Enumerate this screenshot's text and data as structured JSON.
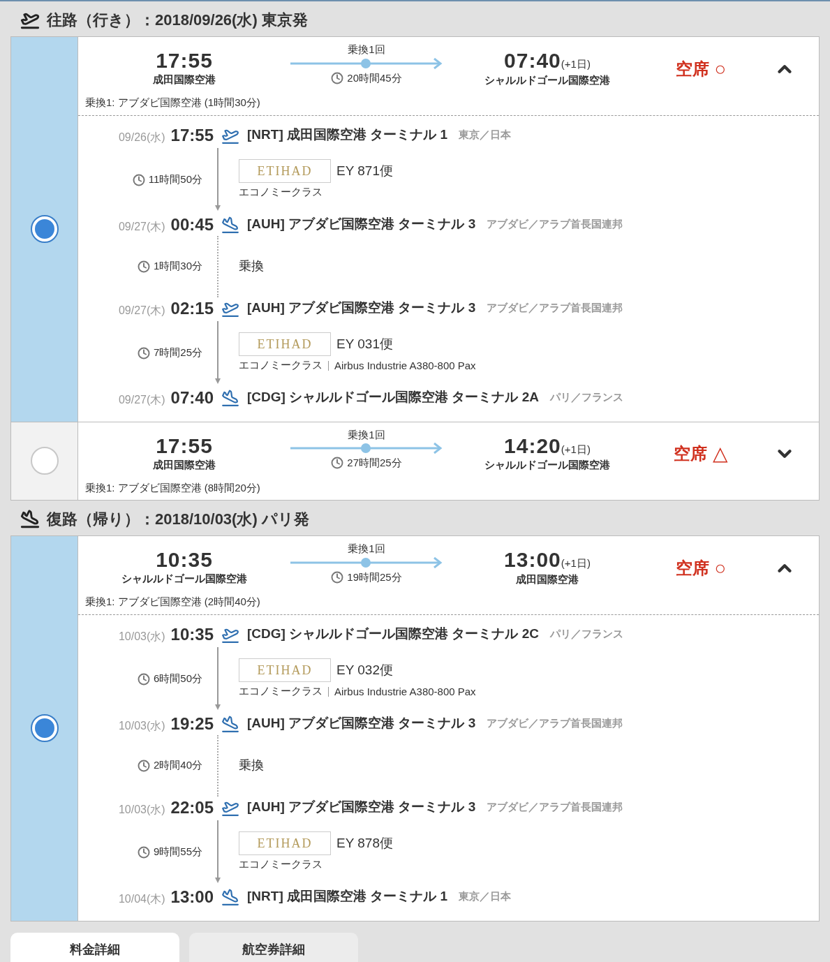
{
  "sections": [
    {
      "kind": "outbound",
      "title": "往路（行き）：2018/09/26(水) 東京発",
      "options": [
        {
          "selected": true,
          "expanded": true,
          "depart_time": "17:55",
          "depart_airport": "成田国際空港",
          "stops": "乗換1回",
          "duration": "20時間45分",
          "arrive_time": "07:40",
          "arrive_day": "(+1日)",
          "arrive_airport": "シャルルドゴール国際空港",
          "availability": "空席",
          "availability_mark": "○",
          "transfer_note": "乗換1: アブダビ国際空港 (1時間30分)",
          "timeline": [
            {
              "kind": "departure",
              "date": "09/26(水)",
              "time": "17:55",
              "airport": "[NRT] 成田国際空港 ターミナル 1",
              "region": "東京／日本"
            },
            {
              "kind": "flight",
              "duration": "11時間50分",
              "logo": "ETIHAD",
              "flight_no": "EY 871便",
              "cabin": "エコノミークラス"
            },
            {
              "kind": "arrival",
              "date": "09/27(木)",
              "time": "00:45",
              "airport": "[AUH] アブダビ国際空港 ターミナル 3",
              "region": "アブダビ／アラブ首長国連邦"
            },
            {
              "kind": "transfer",
              "duration": "1時間30分",
              "label": "乗換"
            },
            {
              "kind": "departure",
              "date": "09/27(木)",
              "time": "02:15",
              "airport": "[AUH] アブダビ国際空港 ターミナル 3",
              "region": "アブダビ／アラブ首長国連邦"
            },
            {
              "kind": "flight",
              "duration": "7時間25分",
              "logo": "ETIHAD",
              "flight_no": "EY 031便",
              "cabin": "エコノミークラス",
              "aircraft": "Airbus Industrie A380-800 Pax"
            },
            {
              "kind": "arrival",
              "date": "09/27(木)",
              "time": "07:40",
              "airport": "[CDG] シャルルドゴール国際空港 ターミナル 2A",
              "region": "パリ／フランス"
            }
          ]
        },
        {
          "selected": false,
          "expanded": false,
          "depart_time": "17:55",
          "depart_airport": "成田国際空港",
          "stops": "乗換1回",
          "duration": "27時間25分",
          "arrive_time": "14:20",
          "arrive_day": "(+1日)",
          "arrive_airport": "シャルルドゴール国際空港",
          "availability": "空席",
          "availability_mark": "△",
          "transfer_note": "乗換1: アブダビ国際空港 (8時間20分)"
        }
      ]
    },
    {
      "kind": "inbound",
      "title": "復路（帰り）：2018/10/03(水) パリ発",
      "options": [
        {
          "selected": true,
          "expanded": true,
          "depart_time": "10:35",
          "depart_airport": "シャルルドゴール国際空港",
          "stops": "乗換1回",
          "duration": "19時間25分",
          "arrive_time": "13:00",
          "arrive_day": "(+1日)",
          "arrive_airport": "成田国際空港",
          "availability": "空席",
          "availability_mark": "○",
          "transfer_note": "乗換1: アブダビ国際空港 (2時間40分)",
          "timeline": [
            {
              "kind": "departure",
              "date": "10/03(水)",
              "time": "10:35",
              "airport": "[CDG] シャルルドゴール国際空港 ターミナル 2C",
              "region": "パリ／フランス"
            },
            {
              "kind": "flight",
              "duration": "6時間50分",
              "logo": "ETIHAD",
              "flight_no": "EY 032便",
              "cabin": "エコノミークラス",
              "aircraft": "Airbus Industrie A380-800 Pax"
            },
            {
              "kind": "arrival",
              "date": "10/03(水)",
              "time": "19:25",
              "airport": "[AUH] アブダビ国際空港 ターミナル 3",
              "region": "アブダビ／アラブ首長国連邦"
            },
            {
              "kind": "transfer",
              "duration": "2時間40分",
              "label": "乗換"
            },
            {
              "kind": "departure",
              "date": "10/03(水)",
              "time": "22:05",
              "airport": "[AUH] アブダビ国際空港 ターミナル 3",
              "region": "アブダビ／アラブ首長国連邦"
            },
            {
              "kind": "flight",
              "duration": "9時間55分",
              "logo": "ETIHAD",
              "flight_no": "EY 878便",
              "cabin": "エコノミークラス"
            },
            {
              "kind": "arrival",
              "date": "10/04(木)",
              "time": "13:00",
              "airport": "[NRT] 成田国際空港 ターミナル 1",
              "region": "東京／日本"
            }
          ]
        }
      ]
    }
  ],
  "tabs": [
    {
      "label": "料金詳細",
      "selected": true
    },
    {
      "label": "航空券詳細",
      "selected": false
    }
  ]
}
